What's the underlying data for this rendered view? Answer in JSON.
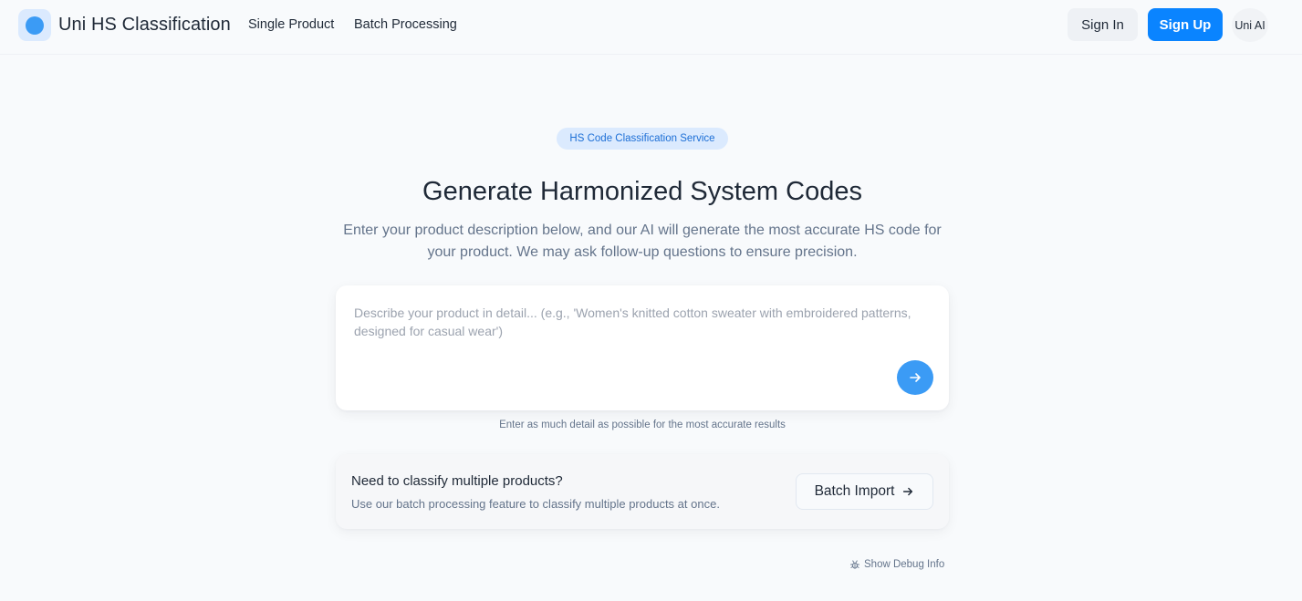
{
  "header": {
    "brand": "Uni HS Classification",
    "nav": {
      "single_product": "Single Product",
      "batch_processing": "Batch Processing"
    },
    "sign_in": "Sign In",
    "sign_up": "Sign Up",
    "account": "Uni AI"
  },
  "hero": {
    "badge": "HS Code Classification Service",
    "title": "Generate Harmonized System Codes",
    "subtitle": "Enter your product description below, and our AI will generate the most accurate HS code for your product. We may ask follow-up questions to ensure precision."
  },
  "input": {
    "value": "",
    "placeholder": "Describe your product in detail... (e.g., 'Women's knitted cotton sweater with embroidered patterns, designed for casual wear')",
    "submit_icon": "arrow-right-icon",
    "hint": "Enter as much detail as possible for the most accurate results"
  },
  "batch": {
    "title": "Need to classify multiple products?",
    "description": "Use our batch processing feature to classify multiple products at once.",
    "button": "Batch Import",
    "button_icon": "arrow-right-icon"
  },
  "debug": {
    "label": "Show Debug Info",
    "icon": "bug-icon"
  },
  "colors": {
    "primary": "#0a84ff",
    "accent": "#3b9bf5",
    "background": "#f8fafc",
    "badge_bg": "#dbeafe",
    "badge_text": "#1d6fd6"
  }
}
